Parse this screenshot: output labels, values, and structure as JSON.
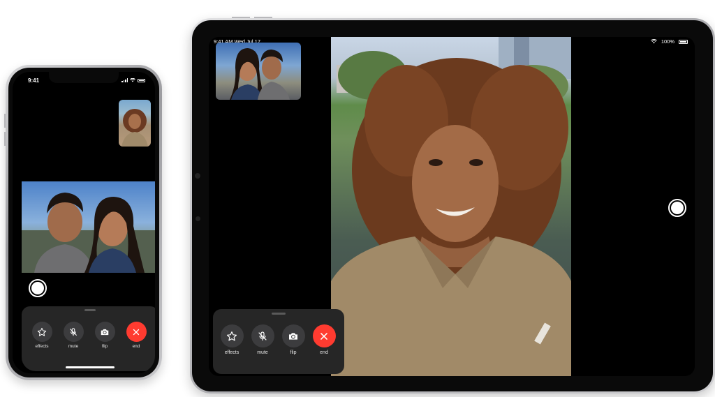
{
  "phone": {
    "status_time": "9:41",
    "controls": [
      {
        "label": "effects",
        "icon": "star-icon"
      },
      {
        "label": "mute",
        "icon": "mic-slash-icon"
      },
      {
        "label": "flip",
        "icon": "camera-flip-icon"
      },
      {
        "label": "end",
        "icon": "close-icon"
      }
    ]
  },
  "ipad": {
    "status_time": "9:41 AM   Wed Jul 17",
    "battery_text": "100%",
    "controls": [
      {
        "label": "effects",
        "icon": "star-icon"
      },
      {
        "label": "mute",
        "icon": "mic-slash-icon"
      },
      {
        "label": "flip",
        "icon": "camera-flip-icon"
      },
      {
        "label": "end",
        "icon": "close-icon"
      }
    ]
  },
  "colors": {
    "end_button": "#ff3b30",
    "control_button": "#3c3c3e",
    "panel": "#262626"
  }
}
